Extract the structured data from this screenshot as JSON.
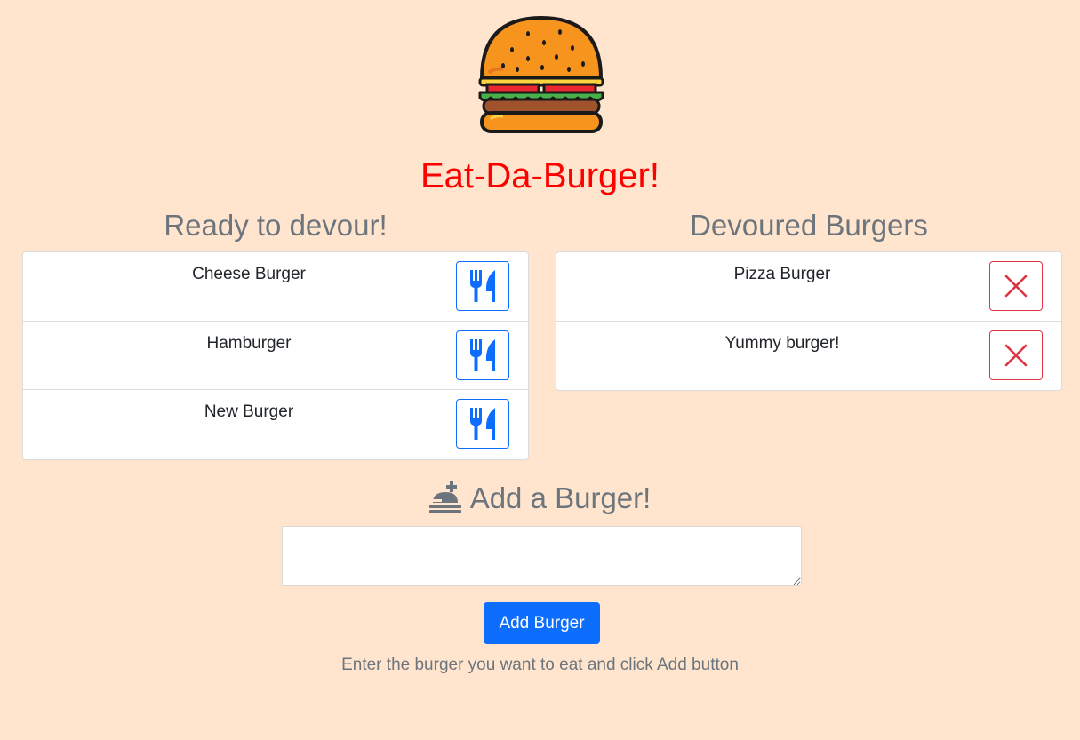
{
  "header": {
    "title": "Eat-Da-Burger!",
    "logo_icon": "hamburger-icon"
  },
  "ready": {
    "heading": "Ready to devour!",
    "items": [
      {
        "label": "Cheese Burger",
        "action_icon": "utensils-icon"
      },
      {
        "label": "Hamburger",
        "action_icon": "utensils-icon"
      },
      {
        "label": "New Burger",
        "action_icon": "utensils-icon"
      }
    ]
  },
  "devoured": {
    "heading": "Devoured Burgers",
    "items": [
      {
        "label": "Pizza Burger",
        "action_icon": "close-icon"
      },
      {
        "label": "Yummy burger!",
        "action_icon": "close-icon"
      }
    ]
  },
  "add": {
    "heading": "Add a Burger!",
    "heading_icon": "concierge-bell-icon",
    "input_value": "",
    "button_label": "Add Burger",
    "help_text": "Enter the burger you want to eat and click Add button"
  },
  "colors": {
    "background": "#ffe5cd",
    "title": "#ff0000",
    "primary": "#0d6efd",
    "danger": "#dc3545",
    "muted": "#6c757d"
  }
}
